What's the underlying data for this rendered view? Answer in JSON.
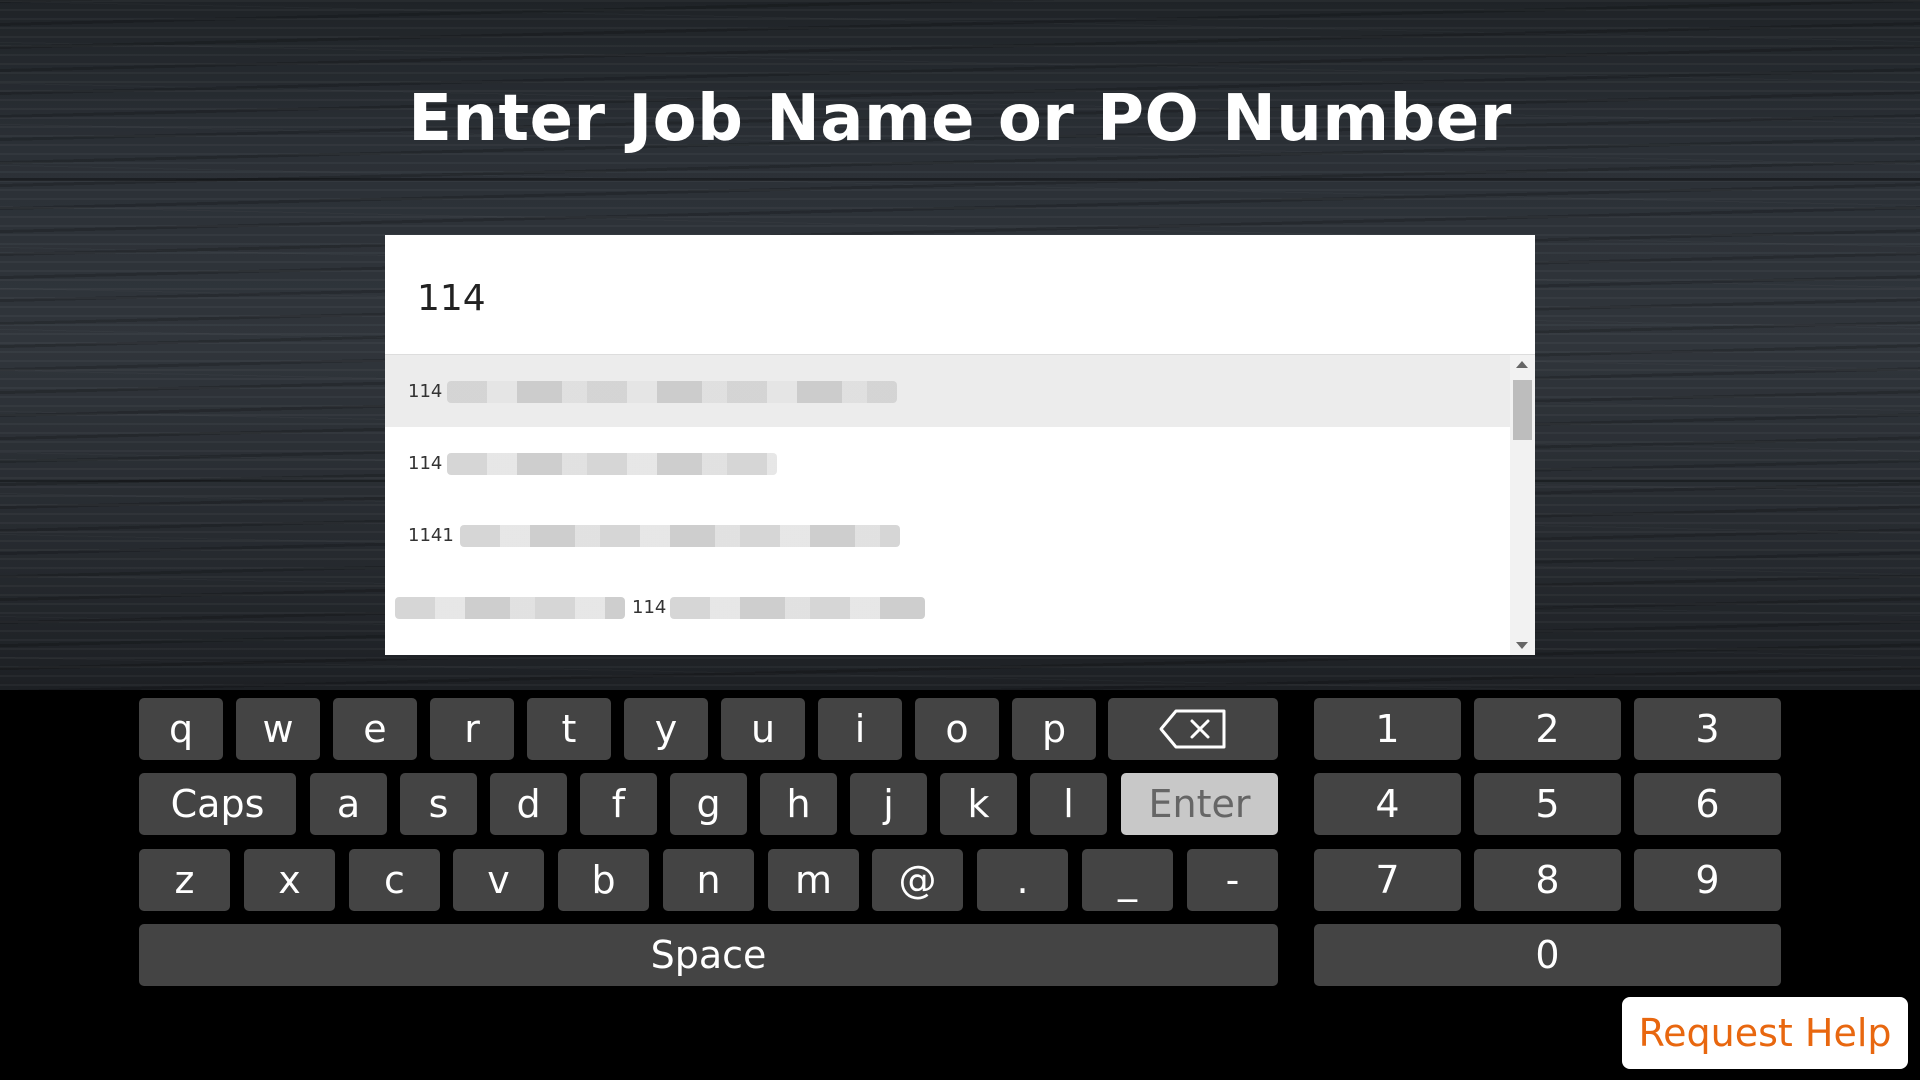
{
  "title": "Enter Job Name or PO Number",
  "search": {
    "value": "114"
  },
  "results": [
    {
      "text": "114",
      "selected": true
    },
    {
      "text": "114",
      "selected": false
    },
    {
      "text": "1141",
      "selected": false
    },
    {
      "text": "114",
      "selected": false
    }
  ],
  "keyboard": {
    "row1": [
      "q",
      "w",
      "e",
      "r",
      "t",
      "y",
      "u",
      "i",
      "o",
      "p"
    ],
    "backspace_icon": "backspace-icon",
    "caps": "Caps",
    "row2": [
      "a",
      "s",
      "d",
      "f",
      "g",
      "h",
      "j",
      "k",
      "l"
    ],
    "enter": "Enter",
    "row3": [
      "z",
      "x",
      "c",
      "v",
      "b",
      "n",
      "m",
      "@",
      ".",
      "_",
      "-"
    ],
    "space": "Space",
    "numpad": [
      "1",
      "2",
      "3",
      "4",
      "5",
      "6",
      "7",
      "8",
      "9"
    ],
    "zero": "0"
  },
  "request_help": "Request Help",
  "colors": {
    "accent": "#e8670f",
    "key": "#444444",
    "enter_key": "#c8c8c8"
  }
}
